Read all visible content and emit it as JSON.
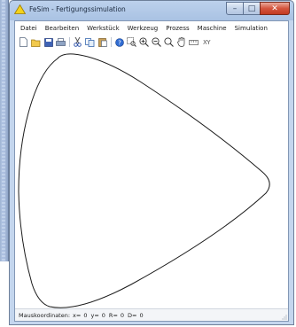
{
  "window": {
    "title": "FeSim - Fertigungssimulation",
    "buttons": {
      "minimize": "–",
      "maximize": "□",
      "close": "✕"
    }
  },
  "menubar": {
    "items": [
      "Datei",
      "Bearbeiten",
      "Werkstück",
      "Werkzeug",
      "Prozess",
      "Maschine",
      "Simulation"
    ]
  },
  "toolbar": {
    "icons": [
      "new-file-icon",
      "open-folder-icon",
      "save-icon",
      "print-icon",
      "cut-icon",
      "copy-icon",
      "paste-icon",
      "help-icon",
      "zoom-window-icon",
      "zoom-in-icon",
      "zoom-out-icon",
      "zoom-fit-icon",
      "pan-hand-icon",
      "measure-icon",
      "xy-coordinates-icon"
    ],
    "xy_label": "XY"
  },
  "statusbar": {
    "label": "Mauskoordinaten:",
    "x_label": "x=",
    "x_value": "0",
    "y_label": "y=",
    "y_value": "0",
    "r_label": "R=",
    "r_value": "0",
    "d_label": "D=",
    "d_value": "0"
  },
  "colors": {
    "titlebar": "#bcd1ec",
    "close_button": "#c23b22",
    "contour": "#1a1a1a"
  }
}
